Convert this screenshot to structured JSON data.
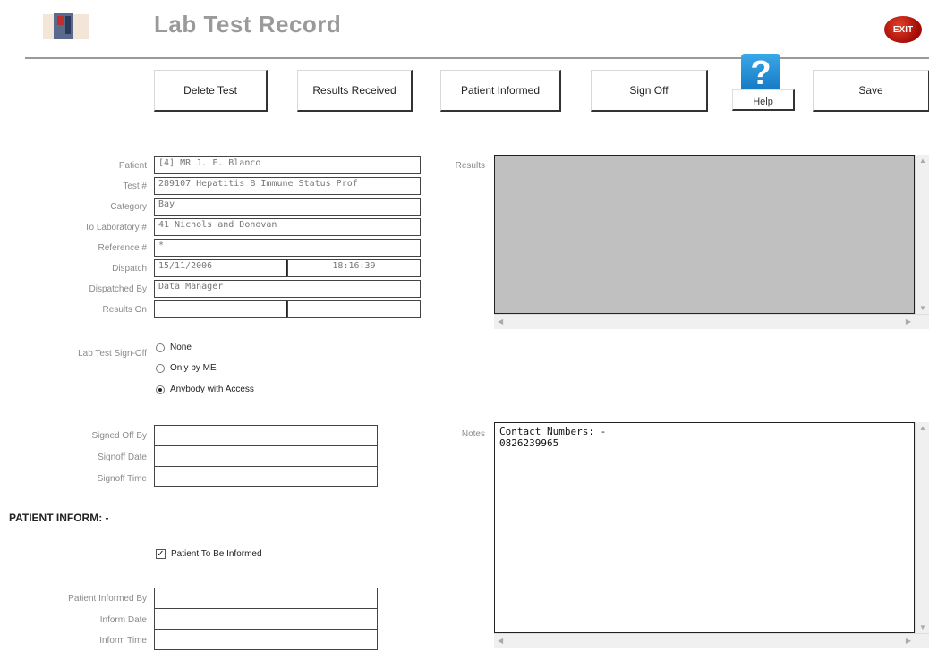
{
  "header": {
    "title": "Lab Test Record",
    "exit_label": "EXIT"
  },
  "toolbar": {
    "delete_test": "Delete Test",
    "results_received": "Results Received",
    "patient_informed": "Patient Informed",
    "sign_off": "Sign Off",
    "help": "Help",
    "help_glyph": "?",
    "save": "Save"
  },
  "record": {
    "patient": {
      "label": "Patient",
      "value": "[4] MR J. F.  Blanco"
    },
    "test_no": {
      "label": "Test #",
      "value": "289107 Hepatitis B Immune Status Prof"
    },
    "category": {
      "label": "Category",
      "value": "Bay"
    },
    "to_laboratory": {
      "label": "To Laboratory #",
      "value": "41 Nichols and Donovan"
    },
    "reference": {
      "label": "Reference #",
      "value": "*"
    },
    "dispatch": {
      "label": "Dispatch",
      "date": "15/11/2006",
      "time": "18:16:39"
    },
    "dispatched_by": {
      "label": "Dispatched By",
      "value": "Data Manager"
    },
    "results_on": {
      "label": "Results On",
      "date": "",
      "time": ""
    }
  },
  "signoff": {
    "label": "Lab Test Sign-Off",
    "options": [
      "None",
      "Only by ME",
      "Anybody with Access"
    ],
    "selected": "Anybody with Access",
    "signed_off_by": {
      "label": "Signed Off By",
      "value": ""
    },
    "signoff_date": {
      "label": "Signoff Date",
      "value": ""
    },
    "signoff_time": {
      "label": "Signoff Time",
      "value": ""
    }
  },
  "patient_inform": {
    "heading": "PATIENT INFORM: -",
    "checkbox_label": "Patient To Be Informed",
    "checked": true,
    "informed_by": {
      "label": "Patient Informed By",
      "value": ""
    },
    "inform_date": {
      "label": "Inform Date",
      "value": ""
    },
    "inform_time": {
      "label": "Inform Time",
      "value": ""
    }
  },
  "results": {
    "label": "Results",
    "value": ""
  },
  "notes": {
    "label": "Notes",
    "line1": "Contact Numbers: -",
    "line2": "0826239965"
  },
  "colors": {
    "results_bg": "#c0c0c0",
    "title": "#9a9a9a",
    "exit": "#b8120a",
    "help": "#1e88d6"
  },
  "icons": {
    "logo": "app-logo-icon",
    "exit": "exit-icon",
    "help": "help-icon"
  }
}
